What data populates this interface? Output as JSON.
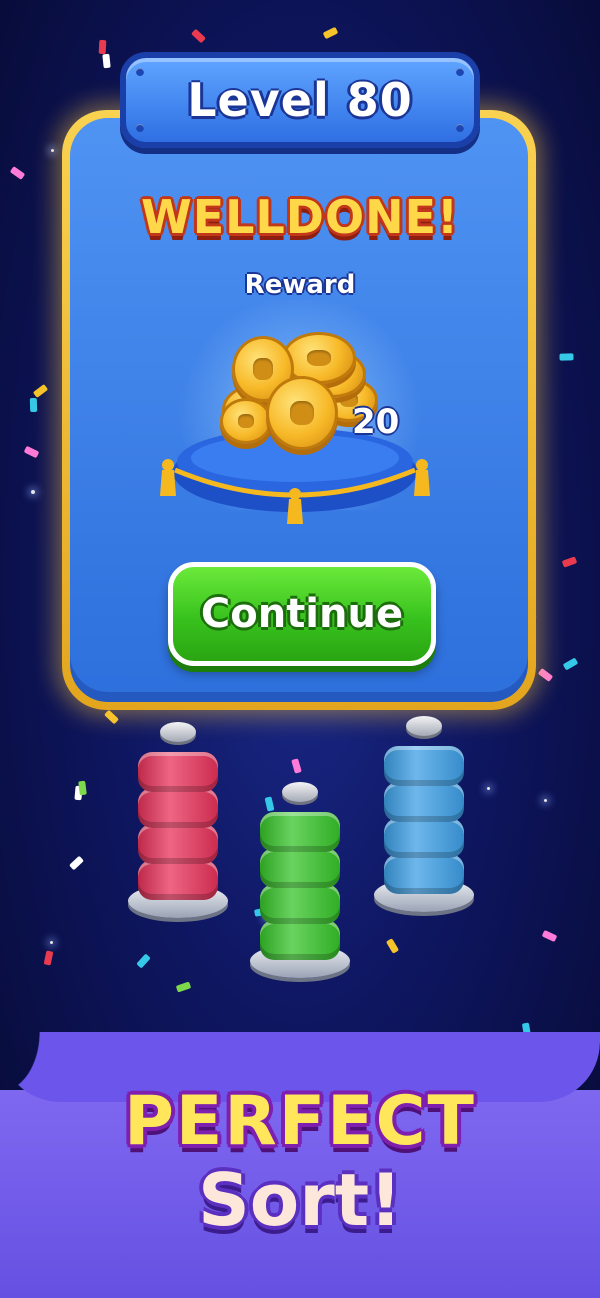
{
  "dialog": {
    "level_title": "Level 80",
    "heading": "WELLDONE!",
    "reward_label": "Reward",
    "reward_amount": "20",
    "reward_icon": "gold-coin-pile",
    "continue_label": "Continue"
  },
  "bolts": [
    {
      "color": "#e8325a",
      "nuts": 4
    },
    {
      "color": "#37c52a",
      "nuts": 4
    },
    {
      "color": "#3d9fe6",
      "nuts": 4
    }
  ],
  "banner": {
    "line1": "PERFECT",
    "line2": "Sort!"
  },
  "colors": {
    "panel_border": "#f0be36",
    "panel_fill": "#3f86ee",
    "button_green": "#38c21e",
    "background": "#0e1660",
    "banner_purple": "#7460ec"
  }
}
